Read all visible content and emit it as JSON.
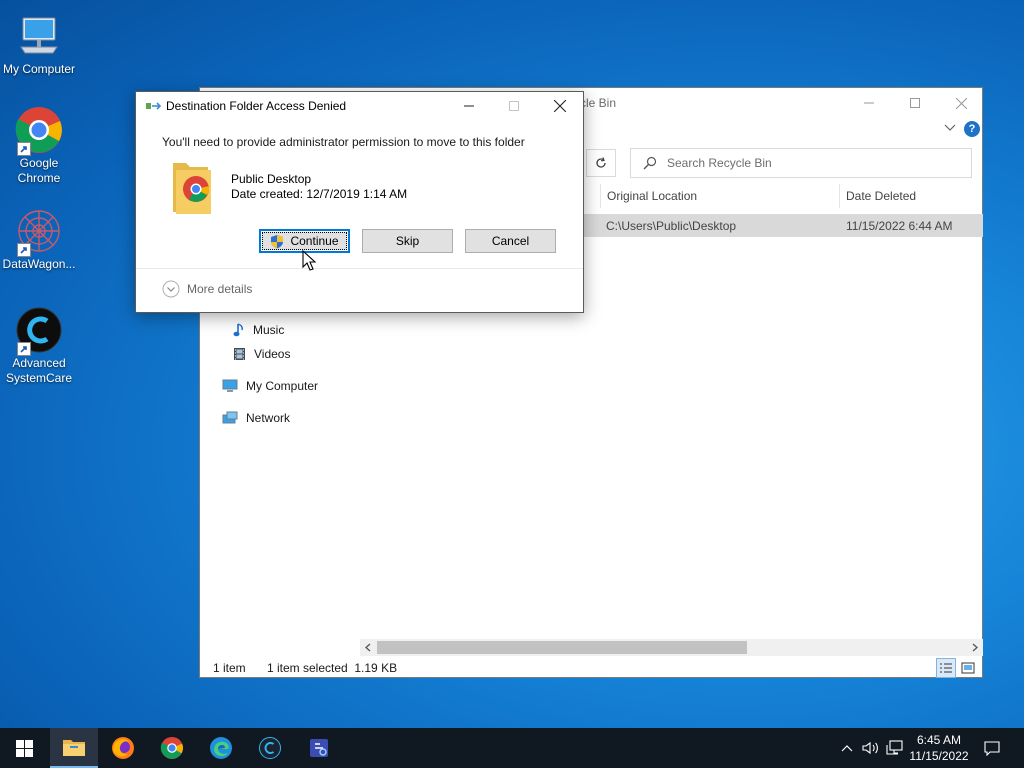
{
  "desktop": {
    "icons": [
      {
        "label": "My Computer"
      },
      {
        "label": "Google Chrome"
      },
      {
        "label": "DataWagon..."
      },
      {
        "label": "Advanced SystemCare"
      }
    ]
  },
  "explorer": {
    "title_fragment": "cle Bin",
    "search_placeholder": "Search Recycle Bin",
    "columns": {
      "original_location": "Original Location",
      "date_deleted": "Date Deleted"
    },
    "selected_row": {
      "location": "C:\\Users\\Public\\Desktop",
      "date": "11/15/2022 6:44 AM"
    },
    "nav": {
      "music": "Music",
      "videos": "Videos",
      "my_computer": "My Computer",
      "network": "Network"
    },
    "status": {
      "items": "1 item",
      "selected": "1 item selected  1.19 KB"
    }
  },
  "dialog": {
    "title": "Destination Folder Access Denied",
    "message": "You'll need to provide administrator permission to move to this folder",
    "folder_name": "Public Desktop",
    "folder_date": "Date created: 12/7/2019 1:14 AM",
    "buttons": {
      "continue": "Continue",
      "skip": "Skip",
      "cancel": "Cancel"
    },
    "more_details": "More details"
  },
  "taskbar": {
    "clock_time": "6:45 AM",
    "clock_date": "11/15/2022"
  },
  "colors": {
    "accent": "#0078d7",
    "taskbar": "#101821",
    "selection": "#d9d9d9"
  }
}
